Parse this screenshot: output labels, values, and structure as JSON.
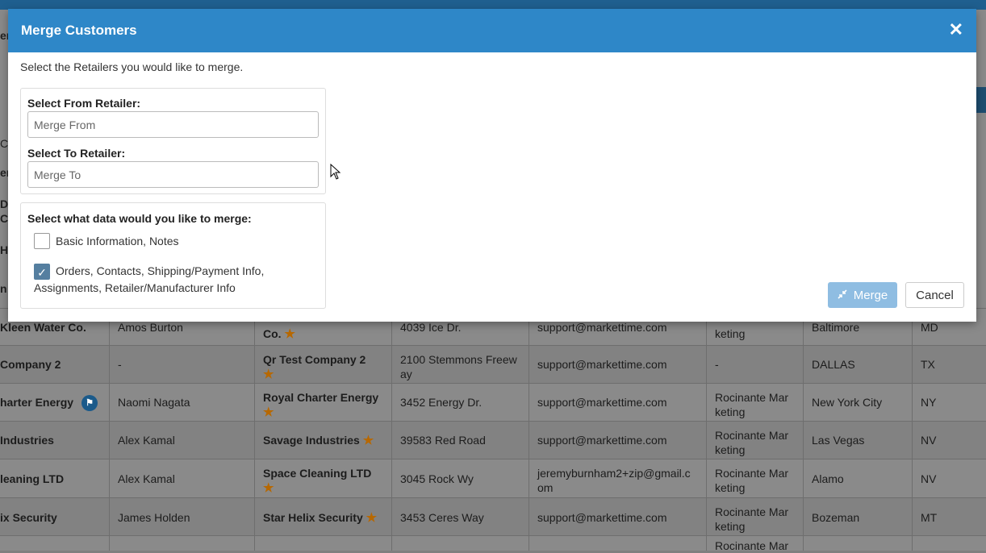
{
  "modal": {
    "title": "Merge Customers",
    "close_icon": "close-icon",
    "intro": "Select the Retailers you would like to merge.",
    "from_label": "Select From Retailer:",
    "from_placeholder": "Merge From",
    "to_label": "Select To Retailer:",
    "to_placeholder": "Merge To",
    "data_label": "Select what data would you like to merge:",
    "options": [
      {
        "label": "Basic Information, Notes",
        "checked": false
      },
      {
        "label_line1": "Orders, Contacts, Shipping/Payment Info,",
        "label_line2": "Assignments, Retailer/Manufacturer Info",
        "checked": true
      }
    ],
    "merge_button": "Merge",
    "merge_icon": "compress-arrows-icon",
    "cancel_button": "Cancel"
  },
  "background": {
    "fragments": [
      "er",
      "Cl",
      "er",
      "De",
      "C",
      "HI",
      "n"
    ],
    "rows": [
      {
        "name": "Kleen Water Co.",
        "contact": "Amos Burton",
        "company": "Co.",
        "address": "4039 Ice Dr.",
        "email": "support@markettime.com",
        "rep": "keting",
        "city": "Baltimore",
        "state": "MD"
      },
      {
        "name": "Company 2",
        "contact": "-",
        "company": "Qr Test Company 2",
        "address_line1": "2100 Stemmons Freew",
        "address_line2": "ay",
        "email": "support@markettime.com",
        "rep": "-",
        "city": "DALLAS",
        "state": "TX"
      },
      {
        "name": "harter Energy",
        "contact": "Naomi Nagata",
        "company": "Royal Charter Energy",
        "address": "3452 Energy Dr.",
        "email": "support@markettime.com",
        "rep_line1": "Rocinante Mar",
        "rep_line2": "keting",
        "city": "New York City",
        "state": "NY"
      },
      {
        "name": "Industries",
        "contact": "Alex Kamal",
        "company": "Savage Industries",
        "address": "39583 Red Road",
        "email": "support@markettime.com",
        "rep_line1": "Rocinante Mar",
        "rep_line2": "keting",
        "city": "Las Vegas",
        "state": "NV"
      },
      {
        "name": "leaning LTD",
        "contact": "Alex Kamal",
        "company": "Space Cleaning LTD",
        "address": "3045 Rock Wy",
        "email_line1": "jeremyburnham2+zip@gmail.c",
        "email_line2": "om",
        "rep_line1": "Rocinante Mar",
        "rep_line2": "keting",
        "city": "Alamo",
        "state": "NV"
      },
      {
        "name": "ix Security",
        "contact": "James Holden",
        "company": "Star Helix Security",
        "address": "3453 Ceres Way",
        "email": "support@markettime.com",
        "rep_line1": "Rocinante Mar",
        "rep_line2": "keting",
        "city": "Bozeman",
        "state": "MT"
      },
      {
        "rep": "Rocinante Mar"
      }
    ]
  }
}
